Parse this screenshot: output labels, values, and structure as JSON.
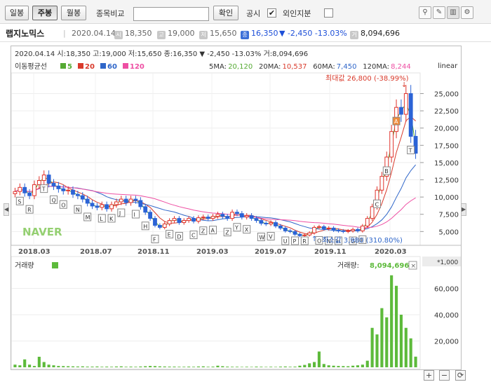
{
  "toolbar": {
    "period_buttons": [
      "일봉",
      "주봉",
      "월봉"
    ],
    "active_period": "주봉",
    "compare_label": "종목비교",
    "compare_value": "",
    "confirm_label": "확인",
    "disclosure_label": "공시",
    "disclosure_checked": "✔",
    "foreign_label": "외인지분"
  },
  "stock": {
    "name": "랩지노믹스",
    "date": "2020.04.14",
    "open_icon": "시",
    "open": "18,350",
    "high_icon": "고",
    "high": "19,000",
    "low_icon": "저",
    "low": "15,650",
    "close_icon": "종",
    "close": "16,350",
    "change": "▼ -2,450 -13.03%",
    "volume_icon": "거",
    "volume": "8,094,696"
  },
  "chart": {
    "header_line": "2020.04.14 시:18,350 고:19,000 저:15,650 종:16,350 ▼ -2,450 -13.03% 거:8,094,696",
    "ma_label": "이동평균선",
    "ma_legend": [
      {
        "label": "5",
        "color": "#55aa33"
      },
      {
        "label": "20",
        "color": "#d93a2b"
      },
      {
        "label": "60",
        "color": "#2f66c9"
      },
      {
        "label": "120",
        "color": "#ee4fa3"
      }
    ],
    "ma_values": [
      {
        "label": "5MA:",
        "value": "20,120",
        "color": "#55aa33"
      },
      {
        "label": "20MA:",
        "value": "10,537",
        "color": "#d93a2b"
      },
      {
        "label": "60MA:",
        "value": "7,450",
        "color": "#2f66c9"
      },
      {
        "label": "120MA:",
        "value": "8,244",
        "color": "#ee4fa3"
      }
    ],
    "scale_label": "linear",
    "max_label": "최대값 26,800 (-38.99%)",
    "min_label": "최소값 3,980 (310.80%)",
    "watermark": "NAVER",
    "price_ticks": [
      "25,000",
      "22,500",
      "20,000",
      "17,500",
      "15,000",
      "12,500",
      "10,000",
      "7,500",
      "5,000"
    ],
    "date_ticks": [
      "2018.03",
      "2018.07",
      "2018.11",
      "2019.03",
      "2019.07",
      "2019.11",
      "2020.03"
    ],
    "event_letters": [
      "S",
      "R",
      "T",
      "Q",
      "O",
      "N",
      "M",
      "L",
      "K",
      "J",
      "I",
      "H",
      "F",
      "E",
      "D",
      "C",
      "Z",
      "A",
      "Z",
      "Y",
      "X",
      "W",
      "V",
      "U",
      "P",
      "R",
      "O",
      "N",
      "H",
      "G",
      "E",
      "C",
      "B",
      "A",
      "T"
    ],
    "volume_label": "거래량",
    "volume_legend_color": "#5dba3b",
    "volume_value_label": "거래량:",
    "volume_value": "8,094,696",
    "volume_unit": "*1,000",
    "volume_ticks": [
      "60,000",
      "40,000",
      "20,000"
    ]
  },
  "chart_data": {
    "type": "candlestick",
    "x_range": [
      "2018.01",
      "2020.04"
    ],
    "ylim": [
      3000,
      28000
    ],
    "scale": "linear",
    "closes": [
      10800,
      11400,
      10600,
      10200,
      11800,
      12400,
      13200,
      12000,
      11600,
      11200,
      10900,
      11000,
      10400,
      10200,
      9700,
      9100,
      8700,
      8500,
      8900,
      8300,
      8900,
      9300,
      9700,
      9200,
      9700,
      9500,
      8600,
      7800,
      6900,
      5900,
      5600,
      6100,
      6600,
      6900,
      6300,
      6600,
      6900,
      6500,
      7000,
      7100,
      6900,
      7200,
      7500,
      7200,
      6900,
      7800,
      7600,
      7100,
      7300,
      6900,
      6600,
      6200,
      6100,
      6300,
      5800,
      5500,
      5100,
      5000,
      4600,
      4400,
      4500,
      4800,
      5600,
      5700,
      5400,
      5500,
      5200,
      5100,
      5000,
      5100,
      5300,
      5100,
      5800,
      6900,
      8600,
      11000,
      13000,
      15800,
      19500,
      23000,
      22000,
      25000,
      18800,
      16350
    ],
    "volume_k": [
      2000,
      1500,
      6000,
      2000,
      1000,
      8000,
      4000,
      2000,
      1500,
      1000,
      900,
      800,
      700,
      600,
      700,
      500,
      500,
      600,
      400,
      500,
      400,
      600,
      700,
      400,
      500,
      400,
      600,
      800,
      1000,
      900,
      700,
      600,
      500,
      500,
      400,
      400,
      500,
      400,
      600,
      700,
      400,
      500,
      1200,
      800,
      500,
      400,
      400,
      300,
      400,
      300,
      500,
      400,
      300,
      400,
      300,
      500,
      600,
      400,
      500,
      1200,
      1800,
      3000,
      4000,
      12000,
      2500,
      1500,
      1200,
      1000,
      900,
      800,
      1200,
      1500,
      2000,
      5000,
      30000,
      25000,
      45000,
      38000,
      70000,
      62000,
      40000,
      30000,
      22000,
      8094
    ]
  }
}
